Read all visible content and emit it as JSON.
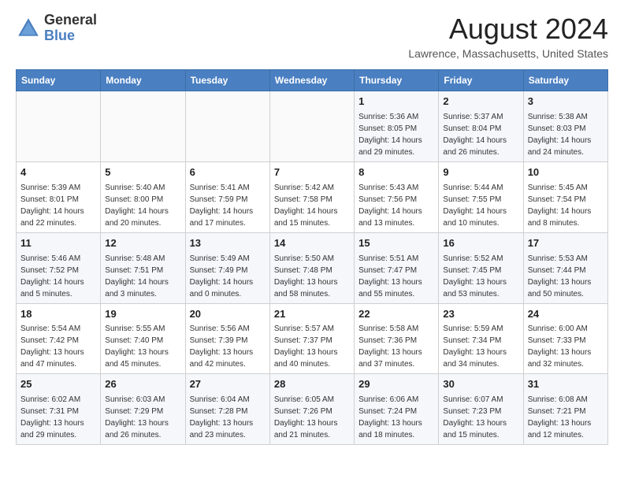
{
  "header": {
    "logo_general": "General",
    "logo_blue": "Blue",
    "month_year": "August 2024",
    "location": "Lawrence, Massachusetts, United States"
  },
  "weekdays": [
    "Sunday",
    "Monday",
    "Tuesday",
    "Wednesday",
    "Thursday",
    "Friday",
    "Saturday"
  ],
  "weeks": [
    [
      {
        "day": "",
        "info": ""
      },
      {
        "day": "",
        "info": ""
      },
      {
        "day": "",
        "info": ""
      },
      {
        "day": "",
        "info": ""
      },
      {
        "day": "1",
        "info": "Sunrise: 5:36 AM\nSunset: 8:05 PM\nDaylight: 14 hours\nand 29 minutes."
      },
      {
        "day": "2",
        "info": "Sunrise: 5:37 AM\nSunset: 8:04 PM\nDaylight: 14 hours\nand 26 minutes."
      },
      {
        "day": "3",
        "info": "Sunrise: 5:38 AM\nSunset: 8:03 PM\nDaylight: 14 hours\nand 24 minutes."
      }
    ],
    [
      {
        "day": "4",
        "info": "Sunrise: 5:39 AM\nSunset: 8:01 PM\nDaylight: 14 hours\nand 22 minutes."
      },
      {
        "day": "5",
        "info": "Sunrise: 5:40 AM\nSunset: 8:00 PM\nDaylight: 14 hours\nand 20 minutes."
      },
      {
        "day": "6",
        "info": "Sunrise: 5:41 AM\nSunset: 7:59 PM\nDaylight: 14 hours\nand 17 minutes."
      },
      {
        "day": "7",
        "info": "Sunrise: 5:42 AM\nSunset: 7:58 PM\nDaylight: 14 hours\nand 15 minutes."
      },
      {
        "day": "8",
        "info": "Sunrise: 5:43 AM\nSunset: 7:56 PM\nDaylight: 14 hours\nand 13 minutes."
      },
      {
        "day": "9",
        "info": "Sunrise: 5:44 AM\nSunset: 7:55 PM\nDaylight: 14 hours\nand 10 minutes."
      },
      {
        "day": "10",
        "info": "Sunrise: 5:45 AM\nSunset: 7:54 PM\nDaylight: 14 hours\nand 8 minutes."
      }
    ],
    [
      {
        "day": "11",
        "info": "Sunrise: 5:46 AM\nSunset: 7:52 PM\nDaylight: 14 hours\nand 5 minutes."
      },
      {
        "day": "12",
        "info": "Sunrise: 5:48 AM\nSunset: 7:51 PM\nDaylight: 14 hours\nand 3 minutes."
      },
      {
        "day": "13",
        "info": "Sunrise: 5:49 AM\nSunset: 7:49 PM\nDaylight: 14 hours\nand 0 minutes."
      },
      {
        "day": "14",
        "info": "Sunrise: 5:50 AM\nSunset: 7:48 PM\nDaylight: 13 hours\nand 58 minutes."
      },
      {
        "day": "15",
        "info": "Sunrise: 5:51 AM\nSunset: 7:47 PM\nDaylight: 13 hours\nand 55 minutes."
      },
      {
        "day": "16",
        "info": "Sunrise: 5:52 AM\nSunset: 7:45 PM\nDaylight: 13 hours\nand 53 minutes."
      },
      {
        "day": "17",
        "info": "Sunrise: 5:53 AM\nSunset: 7:44 PM\nDaylight: 13 hours\nand 50 minutes."
      }
    ],
    [
      {
        "day": "18",
        "info": "Sunrise: 5:54 AM\nSunset: 7:42 PM\nDaylight: 13 hours\nand 47 minutes."
      },
      {
        "day": "19",
        "info": "Sunrise: 5:55 AM\nSunset: 7:40 PM\nDaylight: 13 hours\nand 45 minutes."
      },
      {
        "day": "20",
        "info": "Sunrise: 5:56 AM\nSunset: 7:39 PM\nDaylight: 13 hours\nand 42 minutes."
      },
      {
        "day": "21",
        "info": "Sunrise: 5:57 AM\nSunset: 7:37 PM\nDaylight: 13 hours\nand 40 minutes."
      },
      {
        "day": "22",
        "info": "Sunrise: 5:58 AM\nSunset: 7:36 PM\nDaylight: 13 hours\nand 37 minutes."
      },
      {
        "day": "23",
        "info": "Sunrise: 5:59 AM\nSunset: 7:34 PM\nDaylight: 13 hours\nand 34 minutes."
      },
      {
        "day": "24",
        "info": "Sunrise: 6:00 AM\nSunset: 7:33 PM\nDaylight: 13 hours\nand 32 minutes."
      }
    ],
    [
      {
        "day": "25",
        "info": "Sunrise: 6:02 AM\nSunset: 7:31 PM\nDaylight: 13 hours\nand 29 minutes."
      },
      {
        "day": "26",
        "info": "Sunrise: 6:03 AM\nSunset: 7:29 PM\nDaylight: 13 hours\nand 26 minutes."
      },
      {
        "day": "27",
        "info": "Sunrise: 6:04 AM\nSunset: 7:28 PM\nDaylight: 13 hours\nand 23 minutes."
      },
      {
        "day": "28",
        "info": "Sunrise: 6:05 AM\nSunset: 7:26 PM\nDaylight: 13 hours\nand 21 minutes."
      },
      {
        "day": "29",
        "info": "Sunrise: 6:06 AM\nSunset: 7:24 PM\nDaylight: 13 hours\nand 18 minutes."
      },
      {
        "day": "30",
        "info": "Sunrise: 6:07 AM\nSunset: 7:23 PM\nDaylight: 13 hours\nand 15 minutes."
      },
      {
        "day": "31",
        "info": "Sunrise: 6:08 AM\nSunset: 7:21 PM\nDaylight: 13 hours\nand 12 minutes."
      }
    ]
  ]
}
